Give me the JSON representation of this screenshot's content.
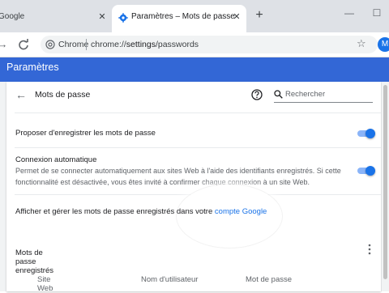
{
  "tabs": {
    "inactive_title": "Google",
    "active_title": "Paramètres – Mots de passe",
    "close_glyph": "✕",
    "new_tab_glyph": "+"
  },
  "window": {
    "minimize_glyph": "—",
    "maximize_glyph": "☐"
  },
  "toolbar": {
    "back_glyph": "→",
    "reload_glyph": "C",
    "site_label": "Chrome",
    "url_prefix": "chrome://",
    "url_host": "settings",
    "url_path": "/passwords",
    "bookmark_glyph": "☆",
    "avatar_letter": "M"
  },
  "settings": {
    "header_title": "Paramètres",
    "page_title": "Mots de passe",
    "search_placeholder": "Rechercher",
    "offer_to_save_label": "Proposer d'enregistrer les mots de passe",
    "offer_to_save_enabled": true,
    "auto_signin_label": "Connexion automatique",
    "auto_signin_desc": "Permet de se connecter automatiquement aux sites Web à l'aide des identifiants enregistrés. Si cette fonctionnalité est désactivée, vous êtes invité à confirmer chaque connexion à un site Web.",
    "auto_signin_enabled": true,
    "manage_text": "Afficher et gérer les mots de passe enregistrés dans votre ",
    "manage_link": "compte Google",
    "saved_section_title": "Mots de passe enregistrés",
    "columns": [
      "Site Web",
      "Nom d'utilisateur",
      "Mot de passe"
    ]
  },
  "colors": {
    "header_blue": "#3367d6",
    "link_blue": "#1a73e8",
    "toggle_on": "#1a73e8"
  }
}
